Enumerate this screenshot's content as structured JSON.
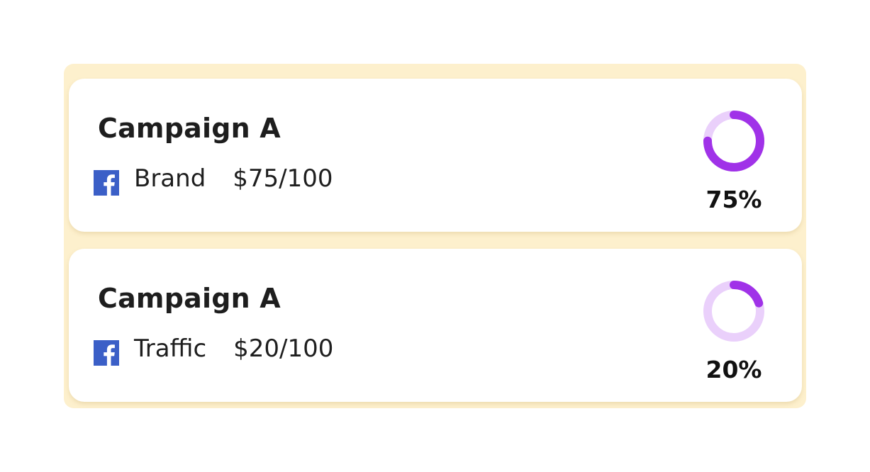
{
  "colors": {
    "panel_bg": "#fdf0cd",
    "card_bg": "#ffffff",
    "ring_track": "#ead0fb",
    "ring_fill": "#a032e8",
    "facebook_blue": "#3b5fc7"
  },
  "campaigns": [
    {
      "title": "Campaign A",
      "platform_icon": "facebook-icon",
      "type": "Brand",
      "budget": "$75/100",
      "progress": 0.75,
      "percent_label": "75%"
    },
    {
      "title": "Campaign A",
      "platform_icon": "facebook-icon",
      "type": "Traffic",
      "budget": "$20/100",
      "progress": 0.2,
      "percent_label": "20%"
    }
  ]
}
